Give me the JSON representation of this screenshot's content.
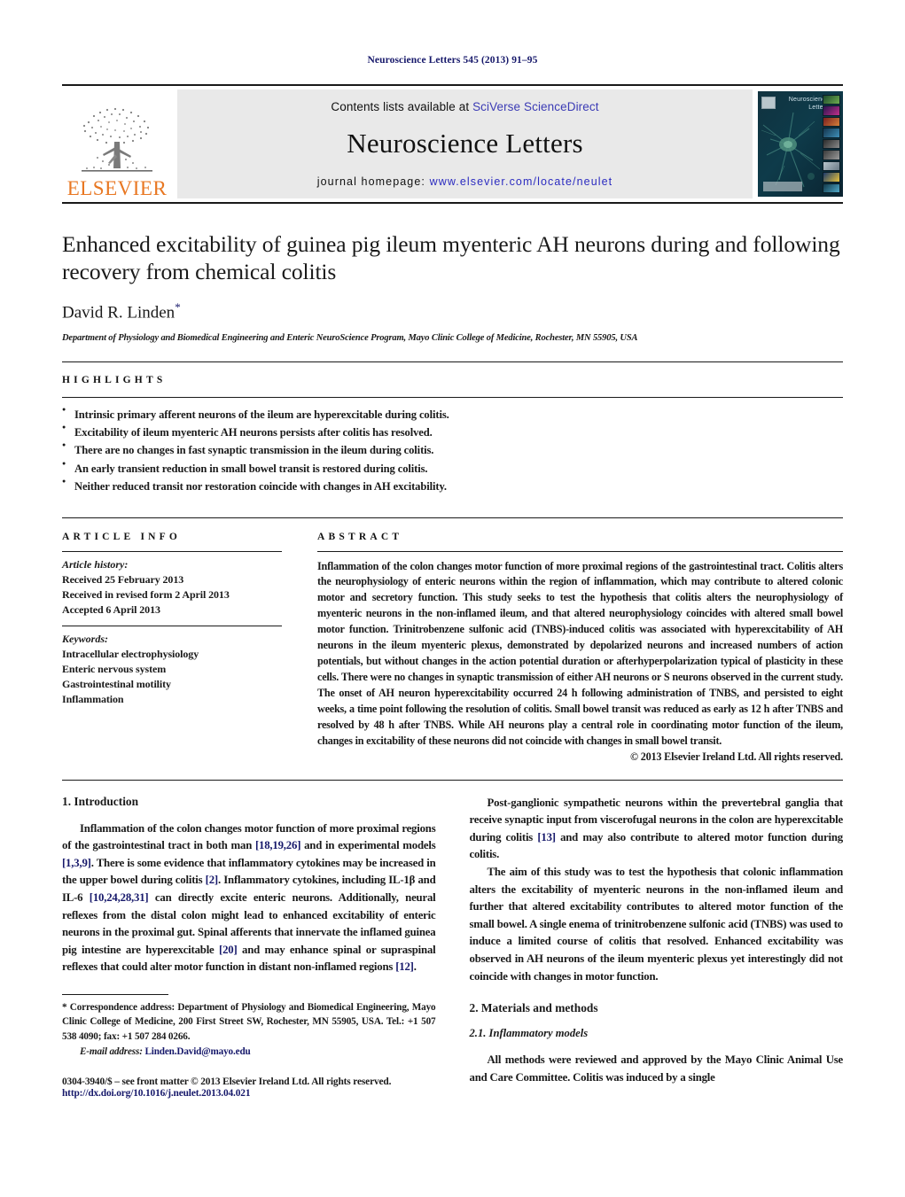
{
  "running_head": "Neuroscience Letters 545 (2013) 91–95",
  "masthead": {
    "publisher_wordmark": "ELSEVIER",
    "contents_prefix": "Contents lists available at ",
    "contents_link": "SciVerse ScienceDirect",
    "journal_name": "Neuroscience Letters",
    "homepage_prefix": "journal homepage: ",
    "homepage_url": "www.elsevier.com/locate/neulet",
    "cover_title": "Neuroscience Letters",
    "link_color": "#3b3bb5",
    "url_color": "#2b2bc0",
    "wordmark_color": "#e87722"
  },
  "title": "Enhanced excitability of guinea pig ileum myenteric AH neurons during and following recovery from chemical colitis",
  "author": "David R. Linden",
  "author_marker": "*",
  "affiliation": "Department of Physiology and Biomedical Engineering and Enteric NeuroScience Program, Mayo Clinic College of Medicine, Rochester, MN 55905, USA",
  "highlights": {
    "heading": "HIGHLIGHTS",
    "items": [
      "Intrinsic primary afferent neurons of the ileum are hyperexcitable during colitis.",
      "Excitability of ileum myenteric AH neurons persists after colitis has resolved.",
      "There are no changes in fast synaptic transmission in the ileum during colitis.",
      "An early transient reduction in small bowel transit is restored during colitis.",
      "Neither reduced transit nor restoration coincide with changes in AH excitability."
    ]
  },
  "article_info": {
    "heading": "ARTICLE INFO",
    "history_label": "Article history:",
    "history": [
      "Received 25 February 2013",
      "Received in revised form 2 April 2013",
      "Accepted 6 April 2013"
    ],
    "keywords_label": "Keywords:",
    "keywords": [
      "Intracellular electrophysiology",
      "Enteric nervous system",
      "Gastrointestinal motility",
      "Inflammation"
    ]
  },
  "abstract": {
    "heading": "ABSTRACT",
    "text": "Inflammation of the colon changes motor function of more proximal regions of the gastrointestinal tract. Colitis alters the neurophysiology of enteric neurons within the region of inflammation, which may contribute to altered colonic motor and secretory function. This study seeks to test the hypothesis that colitis alters the neurophysiology of myenteric neurons in the non-inflamed ileum, and that altered neurophysiology coincides with altered small bowel motor function. Trinitrobenzene sulfonic acid (TNBS)-induced colitis was associated with hyperexcitability of AH neurons in the ileum myenteric plexus, demonstrated by depolarized neurons and increased numbers of action potentials, but without changes in the action potential duration or afterhyperpolarization typical of plasticity in these cells. There were no changes in synaptic transmission of either AH neurons or S neurons observed in the current study. The onset of AH neuron hyperexcitability occurred 24 h following administration of TNBS, and persisted to eight weeks, a time point following the resolution of colitis. Small bowel transit was reduced as early as 12 h after TNBS and resolved by 48 h after TNBS. While AH neurons play a central role in coordinating motor function of the ileum, changes in excitability of these neurons did not coincide with changes in small bowel transit.",
    "copyright": "© 2013 Elsevier Ireland Ltd. All rights reserved."
  },
  "body": {
    "intro_heading": "1. Introduction",
    "intro_p1_a": "Inflammation of the colon changes motor function of more proximal regions of the gastrointestinal tract in both man ",
    "intro_p1_ref1": "[18,19,26]",
    "intro_p1_b": " and in experimental models ",
    "intro_p1_ref2": "[1,3,9]",
    "intro_p1_c": ". There is some evidence that inflammatory cytokines may be increased in the upper bowel during colitis ",
    "intro_p1_ref3": "[2]",
    "intro_p1_d": ". Inflammatory cytokines, including IL-1β and IL-6 ",
    "intro_p1_ref4": "[10,24,28,31]",
    "intro_p1_e": " can directly excite enteric neurons. Additionally, neural reflexes from the distal colon might lead to enhanced excitability of enteric neurons in the proximal gut. Spinal afferents that innervate the inflamed guinea pig intestine are hyperexcitable ",
    "intro_p1_ref5": "[20]",
    "intro_p1_f": " and may enhance spinal or supraspinal reflexes that could alter motor function in distant non-inflamed regions ",
    "intro_p1_ref6": "[12]",
    "intro_p1_g": ".",
    "intro_p2_a": "Post-ganglionic sympathetic neurons within the prevertebral ganglia that receive synaptic input from viscerofugal neurons in the colon are hyperexcitable during colitis ",
    "intro_p2_ref1": "[13]",
    "intro_p2_b": " and may also contribute to altered motor function during colitis.",
    "intro_p3": "The aim of this study was to test the hypothesis that colonic inflammation alters the excitability of myenteric neurons in the non-inflamed ileum and further that altered excitability contributes to altered motor function of the small bowel. A single enema of trinitrobenzene sulfonic acid (TNBS) was used to induce a limited course of colitis that resolved. Enhanced excitability was observed in AH neurons of the ileum myenteric plexus yet interestingly did not coincide with changes in motor function.",
    "methods_heading": "2. Materials and methods",
    "methods_sub_heading": "2.1. Inflammatory models",
    "methods_p1": "All methods were reviewed and approved by the Mayo Clinic Animal Use and Care Committee. Colitis was induced by a single"
  },
  "footnote": {
    "correspondence": "* Correspondence address: Department of Physiology and Biomedical Engineering, Mayo Clinic College of Medicine, 200 First Street SW, Rochester, MN 55905, USA. Tel.: +1 507 538 4090; fax: +1 507 284 0266.",
    "email_label": "E-mail address:",
    "email": "Linden.David@mayo.edu"
  },
  "issn": {
    "front_matter": "0304-3940/$ – see front matter © 2013 Elsevier Ireland Ltd. All rights reserved.",
    "doi": "http://dx.doi.org/10.1016/j.neulet.2013.04.021"
  }
}
